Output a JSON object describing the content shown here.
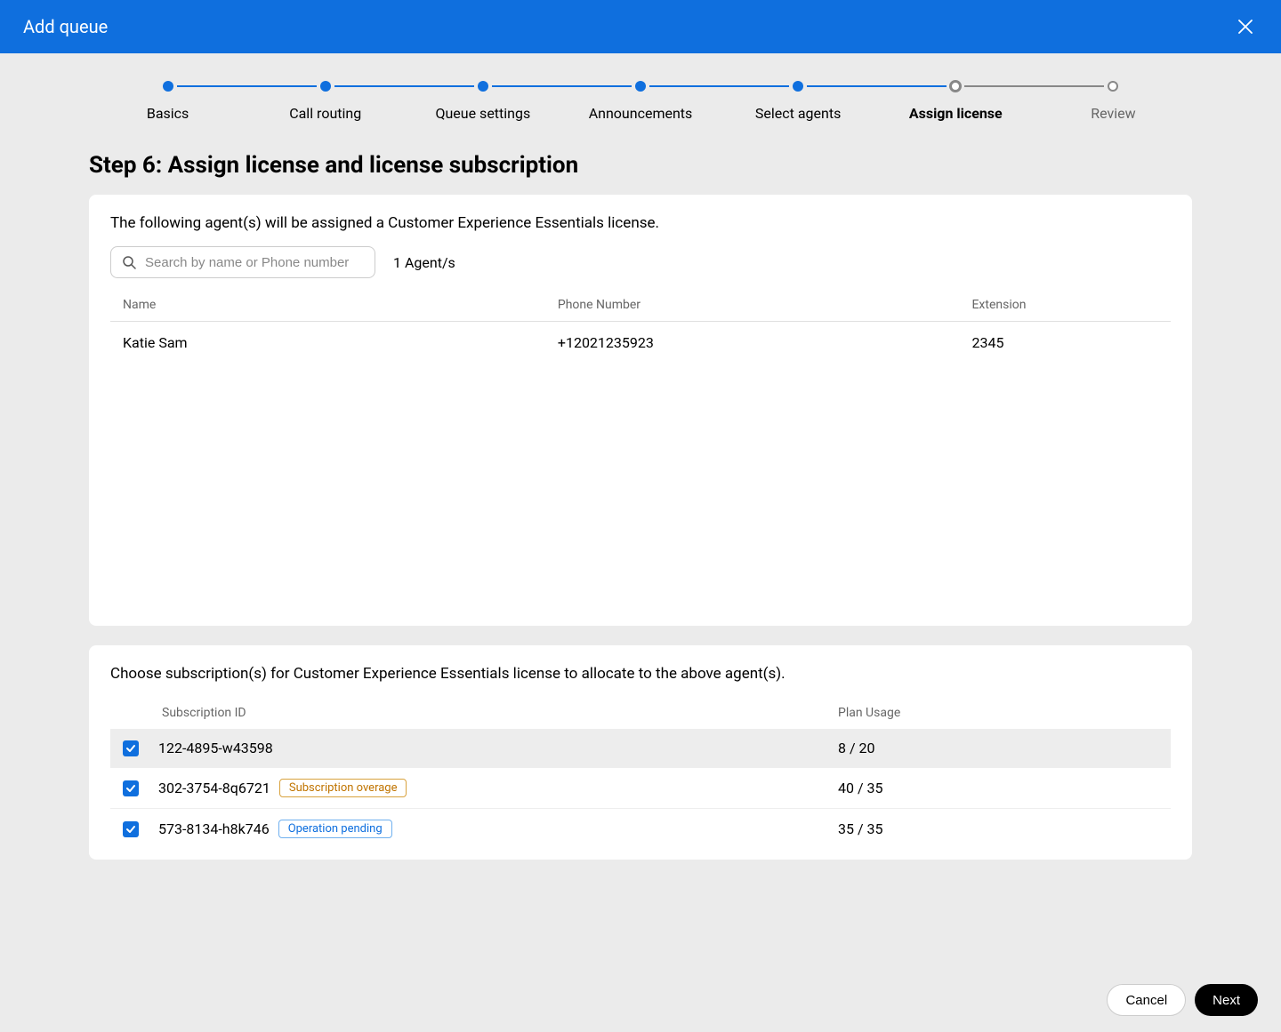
{
  "header": {
    "title": "Add queue"
  },
  "stepper": {
    "steps": [
      {
        "label": "Basics",
        "state": "done"
      },
      {
        "label": "Call routing",
        "state": "done"
      },
      {
        "label": "Queue settings",
        "state": "done"
      },
      {
        "label": "Announcements",
        "state": "done"
      },
      {
        "label": "Select agents",
        "state": "done"
      },
      {
        "label": "Assign license",
        "state": "current"
      },
      {
        "label": "Review",
        "state": "future"
      }
    ]
  },
  "page_title": "Step 6: Assign license and license subscription",
  "agents_panel": {
    "description": "The following agent(s) will be assigned a Customer Experience Essentials license.",
    "search_placeholder": "Search by name or Phone number",
    "count_label": "1 Agent/s",
    "columns": {
      "name": "Name",
      "phone": "Phone Number",
      "ext": "Extension"
    },
    "rows": [
      {
        "name": "Katie Sam",
        "phone": "+12021235923",
        "ext": "2345"
      }
    ]
  },
  "subs_panel": {
    "description": "Choose subscription(s) for Customer Experience Essentials license to allocate to the above agent(s).",
    "columns": {
      "id": "Subscription ID",
      "usage": "Plan Usage"
    },
    "rows": [
      {
        "id": "122-4895-w43598",
        "usage": "8 / 20",
        "badge": null,
        "checked": true,
        "selected": true
      },
      {
        "id": "302-3754-8q6721",
        "usage": "40 / 35",
        "badge": {
          "text": "Subscription overage",
          "type": "warn"
        },
        "checked": true,
        "selected": false
      },
      {
        "id": "573-8134-h8k746",
        "usage": "35 / 35",
        "badge": {
          "text": "Operation pending",
          "type": "info"
        },
        "checked": true,
        "selected": false
      }
    ]
  },
  "footer": {
    "cancel": "Cancel",
    "next": "Next"
  }
}
